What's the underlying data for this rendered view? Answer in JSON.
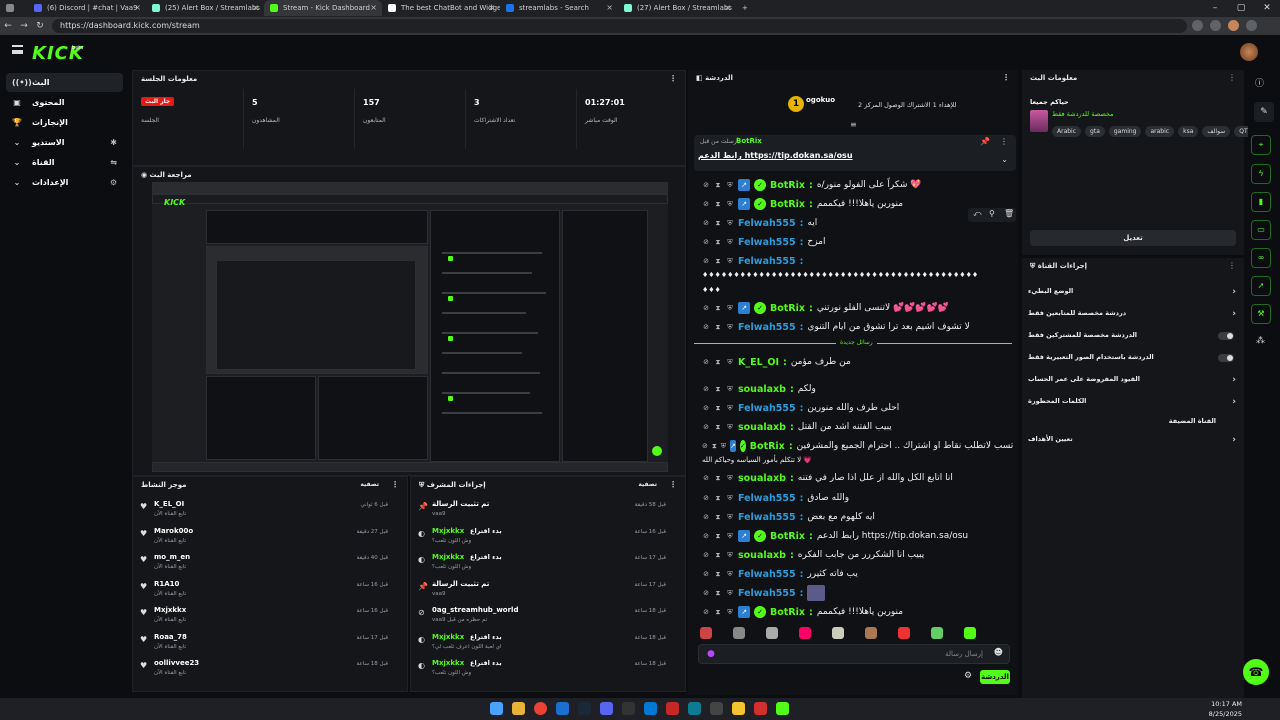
{
  "browser": {
    "tabs": [
      {
        "label": "(6) Discord | #chat | Vaa9",
        "color": "#5865f2"
      },
      {
        "label": "(25) Alert Box / Streamlabs",
        "color": "#80f5d2"
      },
      {
        "label": "Stream - Kick Dashboard",
        "color": "#53fc18"
      },
      {
        "label": "The best ChatBot and Widgets fo",
        "color": "#ffffff"
      },
      {
        "label": "streamlabs - Search",
        "color": "#1a73e8"
      },
      {
        "label": "(27) Alert Box / Streamlabs",
        "color": "#80f5d2"
      }
    ],
    "url": "https://dashboard.kick.com/stream"
  },
  "app": {
    "logo": "KICK",
    "logo_suffix": "beta"
  },
  "nav": [
    {
      "label": "البث",
      "icon": "((•))"
    },
    {
      "label": "المحتوى",
      "icon": "▣"
    },
    {
      "label": "الإنجازات",
      "icon": "🏆"
    },
    {
      "label": "الاستديو",
      "icon": "⌄"
    },
    {
      "label": "القناة",
      "icon": "⌄"
    },
    {
      "label": "الإعدادات",
      "icon": "⌄"
    }
  ],
  "session": {
    "title": "معلومات الجلسة",
    "live_badge": "جار البث",
    "session_label": "الجلسة",
    "stats": [
      {
        "value": "5",
        "label": "المشاهدون"
      },
      {
        "value": "157",
        "label": "المتابعون"
      },
      {
        "value": "3",
        "label": "تعداد الاشتراكات"
      },
      {
        "value": "01:27:01",
        "label": "الوقت مباشر"
      }
    ]
  },
  "preview": {
    "title": "مراجعة البث"
  },
  "activity": {
    "title": "موجز النشاط",
    "filter": "تصفية",
    "items": [
      {
        "name": "K_EL_OI",
        "sub": "تابع القناة الآن",
        "time": "قبل 6 ثواني"
      },
      {
        "name": "Marok00o",
        "sub": "تابع القناة الآن",
        "time": "قبل 27 دقيقة"
      },
      {
        "name": "mo_m_en",
        "sub": "تابع القناة الآن",
        "time": "قبل 40 دقيقة"
      },
      {
        "name": "R1A10",
        "sub": "تابع القناة الآن",
        "time": "قبل 16 ساعة"
      },
      {
        "name": "Mxjxkkx",
        "sub": "تابع القناة الآن",
        "time": "قبل 16 ساعة"
      },
      {
        "name": "Roaa_78",
        "sub": "تابع القناة الآن",
        "time": "قبل 17 ساعة"
      },
      {
        "name": "oollivvee23",
        "sub": "تابع القناة الآن",
        "time": "قبل 18 ساعة"
      }
    ]
  },
  "modactions": {
    "title": "إجراءات المشرف",
    "filter": "تصفية",
    "items": [
      {
        "name": "تم تثبيت الرسالة",
        "sub": "vaa9",
        "time": "قبل 58 دقيقة",
        "green": false
      },
      {
        "name": "Mxjxkkx",
        "sub": "وش اللون تلعب؟",
        "time": "قبل 16 ساعة",
        "green": true,
        "extra": "بدء اقتراع"
      },
      {
        "name": "Mxjxkkx",
        "sub": "وش اللون تلعب؟",
        "time": "قبل 17 ساعة",
        "green": true,
        "extra": "بدء اقتراع"
      },
      {
        "name": "تم تثبيت الرسالة",
        "sub": "vaa9",
        "time": "قبل 17 ساعة",
        "green": false
      },
      {
        "name": "0ag_streamhub_world",
        "sub": "vaa9 تم حظره من قبل",
        "time": "قبل 18 ساعة",
        "green": false
      },
      {
        "name": "Mxjxkkx",
        "sub": "اي لعبة اللون اعرف تلعب لي؟",
        "time": "قبل 18 ساعة",
        "green": true,
        "extra": "بدء اقتراع"
      },
      {
        "name": "Mxjxkkx",
        "sub": "وش اللون تلعب؟",
        "time": "قبل 18 ساعة",
        "green": true,
        "extra": "بدء اقتراع"
      }
    ]
  },
  "chat": {
    "title": "الدردشة",
    "top_user": "ogokuo",
    "top_rank": "1",
    "top_text": "للإهداء 1 الاشتراك الوصول المركز 2",
    "pinned_by": "أرسلت من قبل",
    "pinned_user": "BotRix",
    "pinned_text": "رابط الدعم https://tip.dokan.sa/osu",
    "new_messages": "رسائل جديدة",
    "placeholder": "إرسال رسالة",
    "send": "الدردشة",
    "messages": [
      {
        "user": "BotRix",
        "color": "#53fc18",
        "bot": true,
        "text": "شكراً على الفولو منور/ه 💖"
      },
      {
        "user": "BotRix",
        "color": "#53fc18",
        "bot": true,
        "text": "منورين ياهلا!!! فيكممم"
      },
      {
        "user": "Felwah555",
        "color": "#2d9cdb",
        "bot": false,
        "text": "ايه"
      },
      {
        "user": "Felwah555",
        "color": "#2d9cdb",
        "bot": false,
        "text": "امزح"
      },
      {
        "user": "Felwah555",
        "color": "#2d9cdb",
        "bot": false,
        "text": ""
      },
      {
        "user": "",
        "color": "#ffffff",
        "bot": false,
        "text": "♦♦♦♦♦♦♦♦♦♦♦♦♦♦♦♦♦♦♦♦♦♦♦♦♦♦♦♦♦♦♦♦♦♦♦♦♦♦♦♦♦♦♦♦"
      },
      {
        "user": "",
        "color": "#ffffff",
        "bot": false,
        "text": "♦♦♦"
      },
      {
        "user": "BotRix",
        "color": "#53fc18",
        "bot": true,
        "text": "لاتنسى الفلو نورتني 💕💕💕💕💕"
      },
      {
        "user": "Felwah555",
        "color": "#2d9cdb",
        "bot": false,
        "text": "لا تشوف اشيم بعد ترا تشوق من ايام التنوي"
      },
      {
        "user": "K_EL_OI",
        "color": "#53fc18",
        "bot": false,
        "text": "من طرف مؤمن"
      },
      {
        "user": "soualaxb",
        "color": "#53fc18",
        "bot": false,
        "text": "ولكم"
      },
      {
        "user": "Felwah555",
        "color": "#2d9cdb",
        "bot": false,
        "text": "احلى طرف والله منورين"
      },
      {
        "user": "soualaxb",
        "color": "#53fc18",
        "bot": false,
        "text": "يبيب الفتنه اشد من القتل"
      },
      {
        "user": "BotRix",
        "color": "#53fc18",
        "bot": true,
        "text": "البث: لا تسب لاتطلب نقاط او اشتراك .. احترام الجميع والمشرفين..."
      },
      {
        "user": "",
        "color": "#ffffff",
        "bot": false,
        "text": "لا تتكلم بأمور السياسه وحياكم الله 💗"
      },
      {
        "user": "soualaxb",
        "color": "#53fc18",
        "bot": false,
        "text": "انا اتابع الكل والله از علل اذا صار في فتنه"
      },
      {
        "user": "Felwah555",
        "color": "#2d9cdb",
        "bot": false,
        "text": "والله صادق"
      },
      {
        "user": "Felwah555",
        "color": "#2d9cdb",
        "bot": false,
        "text": "ايه كلهوم مع بعض"
      },
      {
        "user": "BotRix",
        "color": "#53fc18",
        "bot": true,
        "text": "رابط الدعم https://tip.dokan.sa/osu"
      },
      {
        "user": "soualaxb",
        "color": "#53fc18",
        "bot": false,
        "text": "يبيب انا الشكررر من جابب الفكره"
      },
      {
        "user": "Felwah555",
        "color": "#2d9cdb",
        "bot": false,
        "text": "يب فاته كثيرر"
      },
      {
        "user": "Felwah555",
        "color": "#2d9cdb",
        "bot": false,
        "text": "🖼"
      },
      {
        "user": "BotRix",
        "color": "#53fc18",
        "bot": true,
        "text": "منورين ياهلا!!! فيكممم"
      }
    ]
  },
  "streaminfo": {
    "title": "معلومات البث",
    "stream_title": "حياكم جميعا",
    "category": "مخصصة للدردشة فقط",
    "tags": [
      "Arabic",
      "gta",
      "gaming",
      "arabic",
      "ksa",
      "سوالف",
      "QTR"
    ],
    "edit": "تعديل"
  },
  "channelactions": {
    "title": "إجراءات القناة",
    "rows": [
      {
        "label": "الوضع البطيء",
        "type": "chev"
      },
      {
        "label": "دردشة مخصصة للمتابعين فقط",
        "type": "chev"
      },
      {
        "label": "الدردشة مخصصة للمشتركين فقط",
        "type": "toggle"
      },
      {
        "label": "الدردشة باستخدام الصور التعبيرية فقط",
        "type": "toggle"
      },
      {
        "label": "القيود المفروضة على عمر الحساب",
        "type": "chev"
      },
      {
        "label": "الكلمات المحظورة",
        "type": "chev"
      },
      {
        "label": "القناة المضيفة",
        "type": "none"
      },
      {
        "label": "تعيين الأهداف",
        "type": "chev"
      }
    ]
  },
  "clock": {
    "time": "10:17 AM",
    "date": "8/25/2025"
  }
}
